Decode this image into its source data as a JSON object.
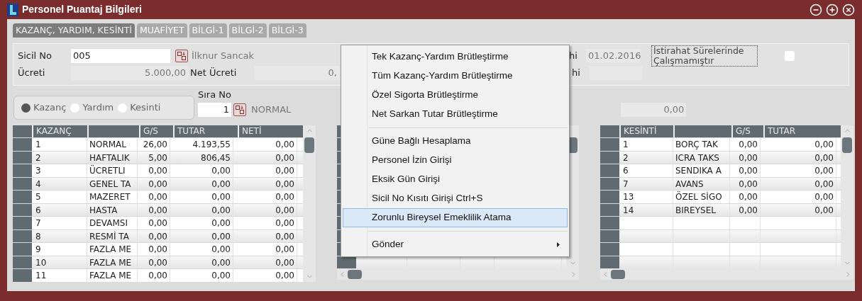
{
  "window": {
    "title": "Personel Puantaj Bilgileri"
  },
  "tabs": [
    {
      "label": "KAZANÇ, YARDIM, KESİNTİ",
      "selected": true
    },
    {
      "label": "MUAFİYET",
      "selected": false
    },
    {
      "label": "BİLGİ-1",
      "selected": false
    },
    {
      "label": "BİLGİ-2",
      "selected": false
    },
    {
      "label": "BİLGİ-3",
      "selected": false
    }
  ],
  "form": {
    "sicil_no_label": "Sicil No",
    "sicil_no_value": "005",
    "employee_name": "İlknur Sancak",
    "ucreti_label": "Ücreti",
    "ucreti_value": "5.000,00",
    "net_ucreti_label": "Net Ücreti",
    "net_ucreti_value": "0,",
    "date_label_1": "hi",
    "date_value_1": "01.02.2016",
    "date_label_2": "hi",
    "rest_checkbox": {
      "label": "İstirahat Sürelerinde Çalışmamıştır",
      "checked": false
    }
  },
  "type_radios": [
    {
      "label": "Kazanç",
      "selected": true
    },
    {
      "label": "Yardım",
      "selected": false
    },
    {
      "label": "Kesinti",
      "selected": false
    }
  ],
  "sira_no": {
    "label": "Sıra No",
    "value": "1",
    "name": "NORMAL"
  },
  "amount_value": "0,00",
  "earnings_table": {
    "columns": [
      "KAZANÇ",
      "",
      "G/S",
      "TUTAR",
      "NETİ"
    ],
    "rows": [
      [
        "1",
        "NORMAL",
        "26,00",
        "4.193,55",
        "0,00"
      ],
      [
        "2",
        "HAFTALIK",
        "5,00",
        "806,45",
        "0,00"
      ],
      [
        "3",
        "ÜCRETLI",
        "0,00",
        "0,00",
        "0,00"
      ],
      [
        "4",
        "GENEL TA",
        "0,00",
        "0,00",
        "0,00"
      ],
      [
        "5",
        "MAZERET",
        "0,00",
        "0,00",
        "0,00"
      ],
      [
        "6",
        "HASTA",
        "0,00",
        "0,00",
        "0,00"
      ],
      [
        "7",
        "DEVAMSI",
        "0,00",
        "0,00",
        "0,00"
      ],
      [
        "8",
        "RESMİ TA",
        "0,00",
        "0,00",
        "0,00"
      ],
      [
        "9",
        "FAZLA ME",
        "0,00",
        "0,00",
        "0,00"
      ],
      [
        "10",
        "FAZLA ME",
        "0,00",
        "0,00",
        "0,00"
      ],
      [
        "11",
        "FAZLA ME",
        "0,00",
        "0,00",
        "0,00"
      ]
    ]
  },
  "deductions_table": {
    "columns": [
      "KESİNTİ",
      "",
      "G/S",
      "TUTAR"
    ],
    "rows": [
      [
        "1",
        "BORÇ TAK",
        "0,00",
        "0,00"
      ],
      [
        "2",
        "ICRA TAKS",
        "0,00",
        "0,00"
      ],
      [
        "6",
        "SENDIKA A",
        "0,00",
        "0,00"
      ],
      [
        "7",
        "AVANS",
        "0,00",
        "0,00"
      ],
      [
        "13",
        "ÖZEL SİGO",
        "0,00",
        "0,00"
      ],
      [
        "14",
        "BIREYSEL",
        "0,00",
        "0,00"
      ]
    ]
  },
  "context_menu": [
    {
      "kind": "item",
      "label": "Tek Kazanç-Yardım Brütleştirme",
      "selected": false
    },
    {
      "kind": "item",
      "label": "Tüm Kazanç-Yardım Brütleştirme",
      "selected": false
    },
    {
      "kind": "item",
      "label": "Özel Sigorta Brütleştirme",
      "selected": false
    },
    {
      "kind": "item",
      "label": "Net Sarkan Tutar Brütleştirme",
      "selected": false
    },
    {
      "kind": "separator"
    },
    {
      "kind": "item",
      "label": "Güne Bağlı Hesaplama",
      "selected": false
    },
    {
      "kind": "item",
      "label": "Personel İzin Girişi",
      "selected": false
    },
    {
      "kind": "item",
      "label": "Eksik Gün Girişi",
      "selected": false
    },
    {
      "kind": "item",
      "label": "Sicil No Kısıtı Girişi Ctrl+S",
      "selected": false
    },
    {
      "kind": "item",
      "label": "Zorunlu Bireysel Emeklilik Atama",
      "selected": true
    },
    {
      "kind": "separator"
    },
    {
      "kind": "submenu",
      "label": "Gönder",
      "selected": false
    }
  ]
}
